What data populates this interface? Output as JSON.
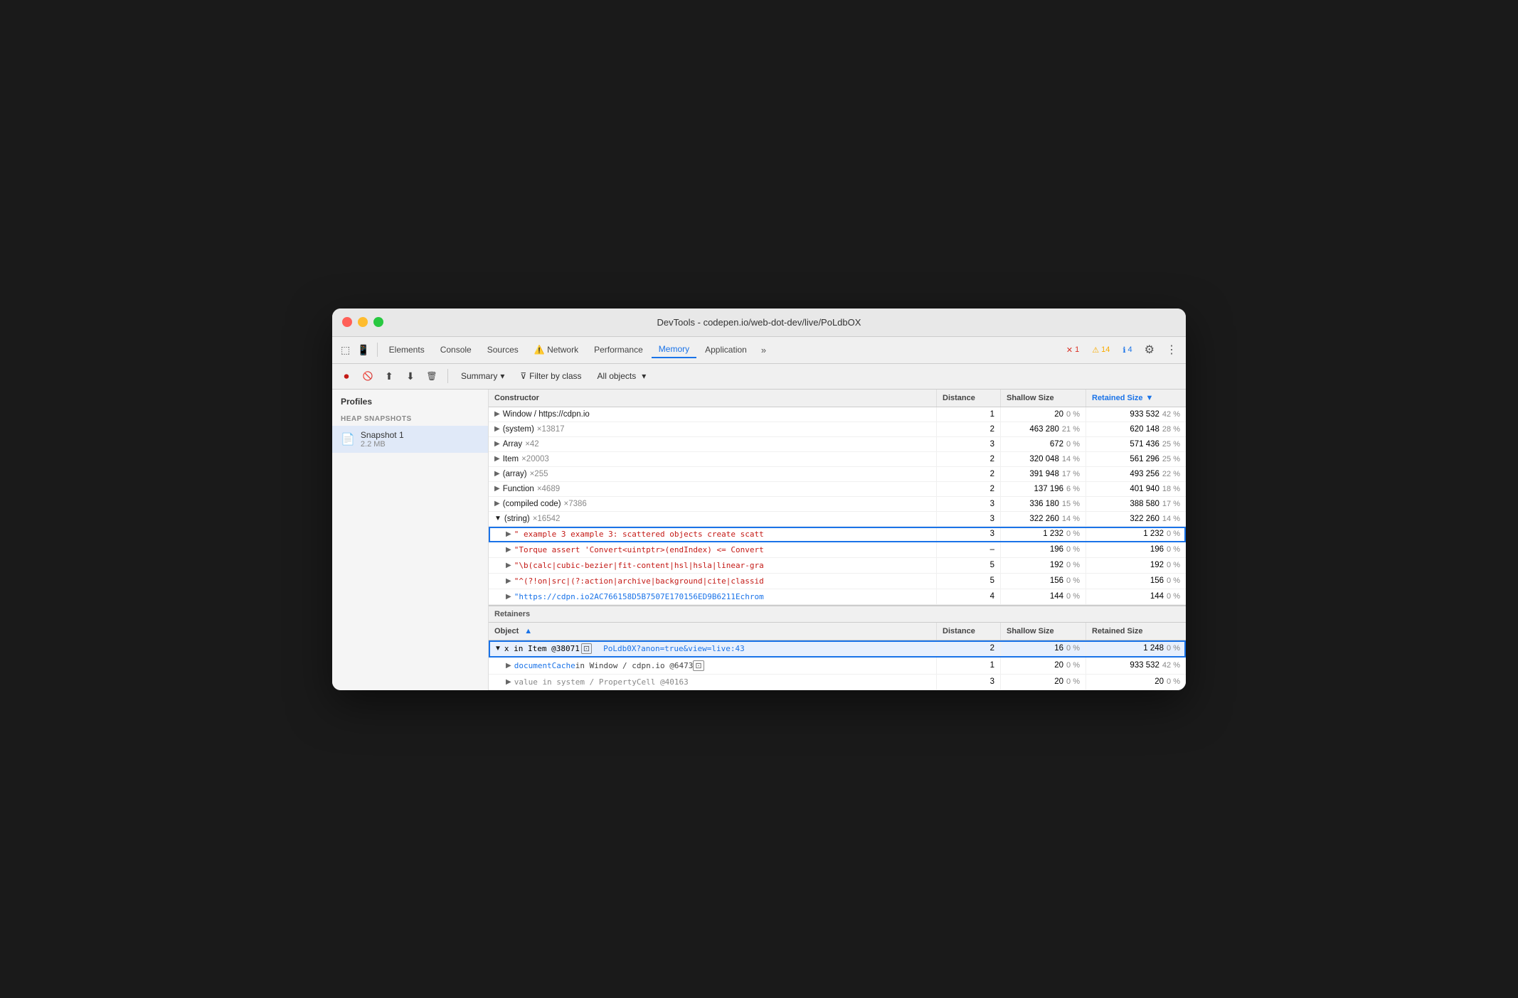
{
  "window": {
    "title": "DevTools - codepen.io/web-dot-dev/live/PoLdbOX"
  },
  "tabs": [
    {
      "label": "Elements",
      "active": false
    },
    {
      "label": "Console",
      "active": false
    },
    {
      "label": "Sources",
      "active": false
    },
    {
      "label": "Network",
      "active": false,
      "icon": "⚠️"
    },
    {
      "label": "Performance",
      "active": false
    },
    {
      "label": "Memory",
      "active": true
    },
    {
      "label": "Application",
      "active": false
    }
  ],
  "badges": {
    "errors": "1",
    "warnings": "14",
    "info": "4"
  },
  "secondary_toolbar": {
    "summary_label": "Summary",
    "filter_label": "Filter by class",
    "objects_label": "All objects"
  },
  "sidebar": {
    "profiles_label": "Profiles",
    "heap_snapshots_label": "HEAP SNAPSHOTS",
    "snapshot": {
      "name": "Snapshot 1",
      "size": "2.2 MB"
    }
  },
  "constructor_table": {
    "columns": [
      "Constructor",
      "Distance",
      "Shallow Size",
      "Retained Size"
    ],
    "rows": [
      {
        "constructor": "Window / https://cdpn.io",
        "count": "",
        "distance": "1",
        "shallow": "20",
        "shallow_pct": "0 %",
        "retained": "933 532",
        "retained_pct": "42 %",
        "indent": 0,
        "expanded": false,
        "type": "normal"
      },
      {
        "constructor": "(system)",
        "count": "×13817",
        "distance": "2",
        "shallow": "463 280",
        "shallow_pct": "21 %",
        "retained": "620 148",
        "retained_pct": "28 %",
        "indent": 0,
        "expanded": false,
        "type": "normal"
      },
      {
        "constructor": "Array",
        "count": "×42",
        "distance": "3",
        "shallow": "672",
        "shallow_pct": "0 %",
        "retained": "571 436",
        "retained_pct": "25 %",
        "indent": 0,
        "expanded": false,
        "type": "normal"
      },
      {
        "constructor": "Item",
        "count": "×20003",
        "distance": "2",
        "shallow": "320 048",
        "shallow_pct": "14 %",
        "retained": "561 296",
        "retained_pct": "25 %",
        "indent": 0,
        "expanded": false,
        "type": "normal"
      },
      {
        "constructor": "(array)",
        "count": "×255",
        "distance": "2",
        "shallow": "391 948",
        "shallow_pct": "17 %",
        "retained": "493 256",
        "retained_pct": "22 %",
        "indent": 0,
        "expanded": false,
        "type": "normal"
      },
      {
        "constructor": "Function",
        "count": "×4689",
        "distance": "2",
        "shallow": "137 196",
        "shallow_pct": "6 %",
        "retained": "401 940",
        "retained_pct": "18 %",
        "indent": 0,
        "expanded": false,
        "type": "normal"
      },
      {
        "constructor": "(compiled code)",
        "count": "×7386",
        "distance": "3",
        "shallow": "336 180",
        "shallow_pct": "15 %",
        "retained": "388 580",
        "retained_pct": "17 %",
        "indent": 0,
        "expanded": false,
        "type": "normal"
      },
      {
        "constructor": "(string)",
        "count": "×16542",
        "distance": "3",
        "shallow": "322 260",
        "shallow_pct": "14 %",
        "retained": "322 260",
        "retained_pct": "14 %",
        "indent": 0,
        "expanded": true,
        "type": "normal"
      },
      {
        "constructor": "\" example 3 example 3: scattered objects create scatt",
        "count": "",
        "distance": "3",
        "shallow": "1 232",
        "shallow_pct": "0 %",
        "retained": "1 232",
        "retained_pct": "0 %",
        "indent": 1,
        "expanded": false,
        "type": "string",
        "highlighted": true
      },
      {
        "constructor": "\"Torque assert 'Convert<uintptr>(endIndex) <= Convert",
        "count": "",
        "distance": "–",
        "shallow": "196",
        "shallow_pct": "0 %",
        "retained": "196",
        "retained_pct": "0 %",
        "indent": 1,
        "expanded": false,
        "type": "string"
      },
      {
        "constructor": "\"\\b(calc|cubic-bezier|fit-content|hsl|hsla|linear-gra",
        "count": "",
        "distance": "5",
        "shallow": "192",
        "shallow_pct": "0 %",
        "retained": "192",
        "retained_pct": "0 %",
        "indent": 1,
        "expanded": false,
        "type": "string"
      },
      {
        "constructor": "\"^(?!on|src|(?:action|archive|background|cite|classid",
        "count": "",
        "distance": "5",
        "shallow": "156",
        "shallow_pct": "0 %",
        "retained": "156",
        "retained_pct": "0 %",
        "indent": 1,
        "expanded": false,
        "type": "string"
      },
      {
        "constructor": "\"https://cdpn.io2AC766158D5B7507E170156ED9B6211Echrom",
        "count": "",
        "distance": "4",
        "shallow": "144",
        "shallow_pct": "0 %",
        "retained": "144",
        "retained_pct": "0 %",
        "indent": 1,
        "expanded": false,
        "type": "url"
      }
    ]
  },
  "retainers": {
    "header": "Retainers",
    "columns": [
      "Object",
      "Distance",
      "Shallow Size",
      "Retained Size"
    ],
    "rows": [
      {
        "object": "x in Item @38071",
        "link": "PoLdb0X?anon=true&view=live:43",
        "distance": "2",
        "shallow": "16",
        "shallow_pct": "0 %",
        "retained": "1 248",
        "retained_pct": "0 %",
        "indent": 0,
        "expanded": true,
        "selected": true,
        "highlighted": true
      },
      {
        "object": "documentCache in Window / cdpn.io @6473",
        "link": "",
        "distance": "1",
        "shallow": "20",
        "shallow_pct": "0 %",
        "retained": "933 532",
        "retained_pct": "42 %",
        "indent": 1,
        "expanded": false,
        "selected": false
      },
      {
        "object": "value in system / PropertyCell @40163",
        "link": "",
        "distance": "3",
        "shallow": "20",
        "shallow_pct": "0 %",
        "retained": "20",
        "retained_pct": "0 %",
        "indent": 1,
        "expanded": false,
        "selected": false
      }
    ]
  }
}
